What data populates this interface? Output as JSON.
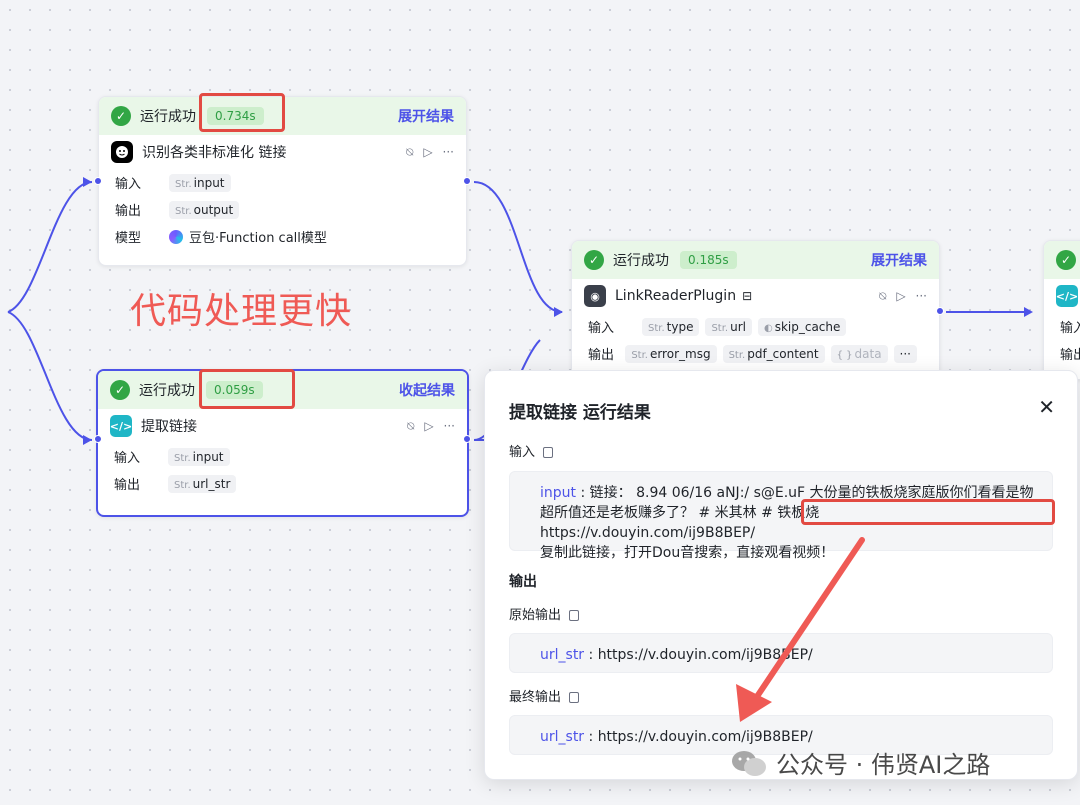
{
  "nodes": {
    "llm": {
      "status": "运行成功",
      "duration": "0.734s",
      "expand": "展开结果",
      "title": "识别各类非标准化 链接",
      "input_label": "输入",
      "input_type": "Str.",
      "input_name": "input",
      "output_label": "输出",
      "output_type": "Str.",
      "output_name": "output",
      "model_label": "模型",
      "model_name": "豆包·Function call模型"
    },
    "code": {
      "status": "运行成功",
      "duration": "0.059s",
      "expand": "收起结果",
      "title": "提取链接",
      "input_label": "输入",
      "input_type": "Str.",
      "input_name": "input",
      "output_label": "输出",
      "output_type": "Str.",
      "output_name": "url_str"
    },
    "plugin": {
      "status": "运行成功",
      "duration": "0.185s",
      "expand": "展开结果",
      "title": "LinkReaderPlugin",
      "input_label": "输入",
      "inputs": [
        {
          "type": "Str.",
          "name": "type"
        },
        {
          "type": "Str.",
          "name": "url"
        },
        {
          "type": "",
          "name": "skip_cache"
        }
      ],
      "output_label": "输出",
      "outputs": [
        {
          "type": "Str.",
          "name": "error_msg"
        },
        {
          "type": "Str.",
          "name": "pdf_content"
        },
        {
          "type": "{ }",
          "name": "data"
        }
      ],
      "more": "···"
    },
    "partial": {
      "input_label": "输入",
      "output_label": "输出"
    }
  },
  "annotation": "代码处理更快",
  "panel": {
    "title": "提取链接 运行结果",
    "close": "✕",
    "input_section": "输入",
    "input_key": "input",
    "input_text_1": "链接： 8.94 06/16 aNJ:/ s@E.uF 大份量的铁板烧家庭版你们看看是物超所值还是老板赚多了？ # 米其林 # 铁板烧 ",
    "input_link": "https://v.douyin.com/ij9B8BEP/",
    "input_text_2": "复制此链接，打开Dou音搜索，直接观看视频！",
    "output_section": "输出",
    "raw_output_label": "原始输出",
    "raw_key": "url_str",
    "raw_value": "https://v.douyin.com/ij9B8BEP/",
    "final_output_label": "最终输出",
    "final_key": "url_str",
    "final_value": "https://v.douyin.com/ij9B8BEP/"
  },
  "watermark": "公众号 · 伟贤AI之路",
  "colors": {
    "accent": "#4d53e8",
    "success": "#32a645",
    "highlight": "#e24a42",
    "annotation": "#ef5a55"
  }
}
